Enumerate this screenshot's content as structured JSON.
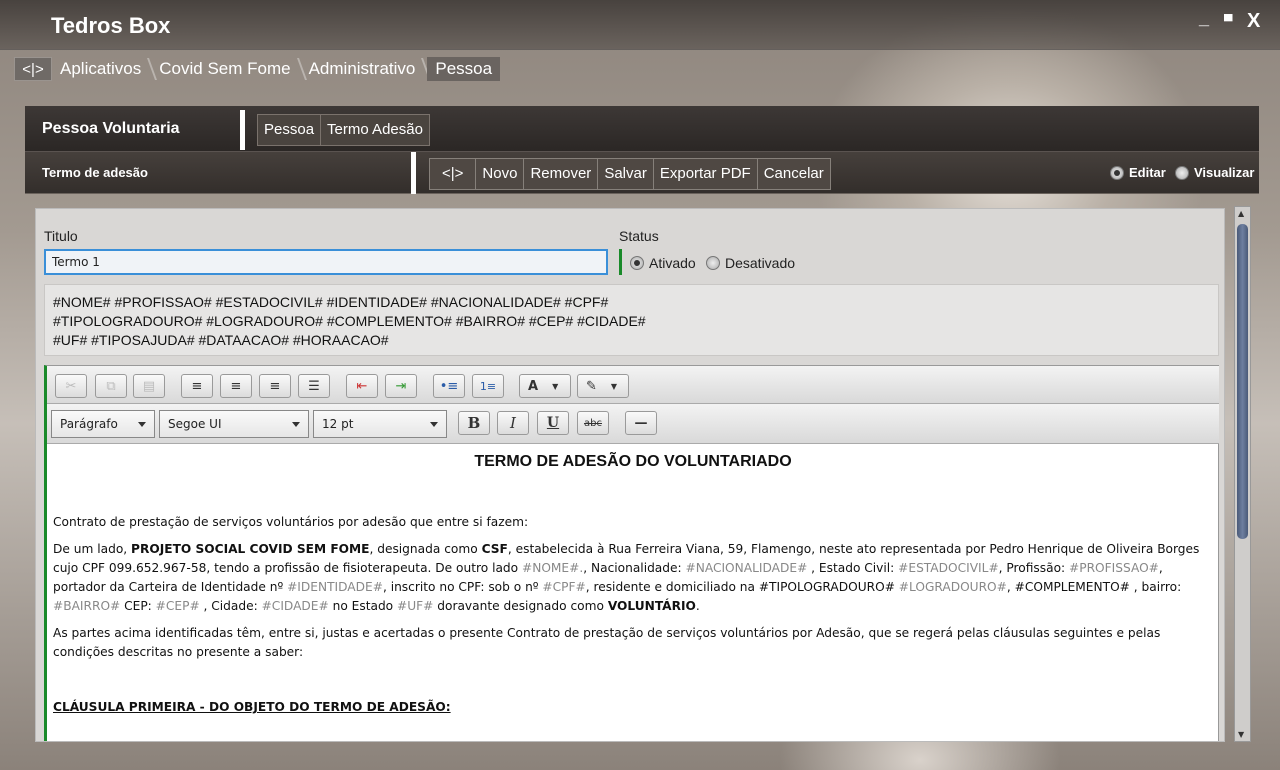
{
  "window": {
    "title": "Tedros Box",
    "controls": {
      "minimize": "_",
      "maximize": "▀",
      "close": "X"
    }
  },
  "breadcrumb": {
    "back": "<|>",
    "items": [
      "Aplicativos",
      "Covid Sem Fome",
      "Administrativo",
      "Pessoa"
    ]
  },
  "panel": {
    "title": "Pessoa Voluntaria",
    "tabs": [
      "Pessoa",
      "Termo Adesão"
    ]
  },
  "subheader": {
    "title": "Termo de adesão",
    "actions": [
      "<|>",
      "Novo",
      "Remover",
      "Salvar",
      "Exportar PDF",
      "Cancelar"
    ],
    "mode": {
      "edit": "Editar",
      "view": "Visualizar",
      "selected": "Editar"
    }
  },
  "form": {
    "titulo_label": "Titulo",
    "titulo_value": "Termo 1",
    "status_label": "Status",
    "status_options": [
      "Ativado",
      "Desativado"
    ],
    "status_selected": "Ativado"
  },
  "tags": {
    "line1": "#NOME# #PROFISSAO# #ESTADOCIVIL# #IDENTIDADE# #NACIONALIDADE# #CPF#",
    "line2": "#TIPOLOGRADOURO# #LOGRADOURO# #COMPLEMENTO# #BAIRRO# #CEP# #CIDADE#",
    "line3": "#UF# #TIPOSAJUDA# #DATAACAO# #HORAACAO#"
  },
  "editor": {
    "paragraph_style": "Parágrafo",
    "font": "Segoe UI",
    "size": "12 pt",
    "bold": "B",
    "italic": "I",
    "underline": "U",
    "strike": "abc",
    "hr": "—",
    "document": {
      "heading": "TERMO DE ADESÃO DO VOLUNTARIADO",
      "intro": "Contrato de prestação de serviços voluntários por adesão que entre si fazem:",
      "p2_a": "De um lado, ",
      "p2_b": "PROJETO SOCIAL COVID SEM FOME",
      "p2_c": ", designada como ",
      "p2_d": "CSF",
      "p2_e": ", estabelecida à Rua Ferreira Viana, 59, Flamengo, neste ato representada por Pedro Henrique de Oliveira Borges cujo CPF 099.652.967-58, tendo a profissão de fisioterapeuta. De outro lado ",
      "ph_nome": "#NOME#.",
      "t_nac": ", Nacionalidade: ",
      "ph_nac": "#NACIONALIDADE#",
      "t_civil": " , Estado Civil: ",
      "ph_civil": "#ESTADOCIVIL#",
      "t_prof": ", Profissão: ",
      "ph_prof": "#PROFISSAO#",
      "t_port": ", portador da Carteira de Identidade nº ",
      "ph_id": "#IDENTIDADE#",
      "t_cpf": ", inscrito no CPF: sob o nº ",
      "ph_cpf": "#CPF#",
      "t_res": ", residente e domiciliado na #TIPOLOGRADOURO# ",
      "ph_log": "#LOGRADOURO#",
      "t_comp": ", #COMPLEMENTO# , bairro: ",
      "ph_bairro": "#BAIRRO#",
      "t_cep": " CEP: ",
      "ph_cep": "#CEP#",
      "t_cid": " , Cidade: ",
      "ph_cid": "#CIDADE#",
      "t_est": " no Estado ",
      "ph_uf": "#UF#",
      "t_dor": " doravante designado como ",
      "t_vol": "VOLUNTÁRIO",
      "t_end": ".",
      "p3": "As partes acima identificadas têm, entre si, justas e acertadas o presente Contrato de prestação de serviços voluntários por Adesão, que se regerá pelas cláusulas seguintes e pelas condições descritas no presente a saber:",
      "clause1": "CLÁUSULA PRIMEIRA - DO OBJETO DO TERMO DE ADESÃO:"
    }
  }
}
